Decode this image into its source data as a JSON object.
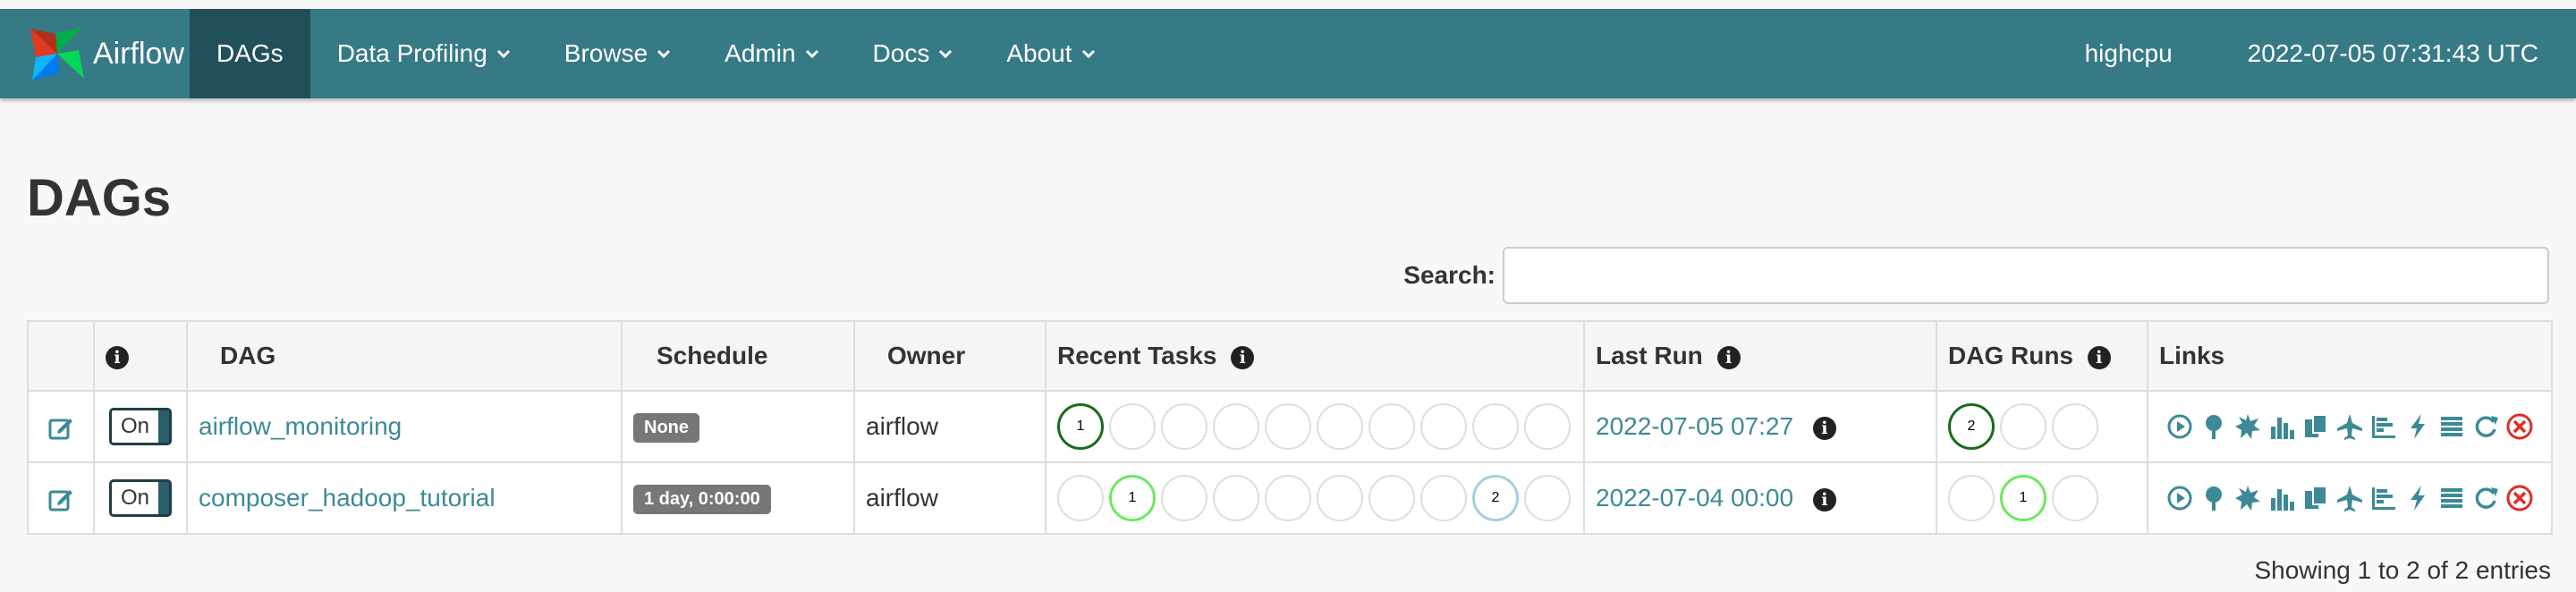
{
  "nav": {
    "brand": "Airflow",
    "items": [
      {
        "label": "DAGs",
        "active": true,
        "dropdown": false
      },
      {
        "label": "Data Profiling",
        "active": false,
        "dropdown": true
      },
      {
        "label": "Browse",
        "active": false,
        "dropdown": true
      },
      {
        "label": "Admin",
        "active": false,
        "dropdown": true
      },
      {
        "label": "Docs",
        "active": false,
        "dropdown": true
      },
      {
        "label": "About",
        "active": false,
        "dropdown": true
      }
    ],
    "hostname": "highcpu",
    "clock": "2022-07-05 07:31:43 UTC"
  },
  "page": {
    "title": "DAGs",
    "search_label": "Search:",
    "search_value": "",
    "footer": "Showing 1 to 2 of 2 entries"
  },
  "table": {
    "headers": {
      "info": "i",
      "dag": "DAG",
      "schedule": "Schedule",
      "owner": "Owner",
      "recent_tasks": "Recent Tasks",
      "last_run": "Last Run",
      "dag_runs": "DAG Runs",
      "links": "Links"
    },
    "rows": [
      {
        "toggle": "On",
        "dag": "airflow_monitoring",
        "schedule": "None",
        "owner": "airflow",
        "recent_tasks": [
          "1",
          "",
          "",
          "",
          "",
          "",
          "",
          "",
          "",
          ""
        ],
        "recent_task_states": [
          "success",
          "",
          "",
          "",
          "",
          "",
          "",
          "",
          "",
          ""
        ],
        "last_run": "2022-07-05 07:27",
        "dag_runs": [
          "2",
          "",
          ""
        ],
        "dag_run_states": [
          "success",
          "",
          ""
        ]
      },
      {
        "toggle": "On",
        "dag": "composer_hadoop_tutorial",
        "schedule": "1 day, 0:00:00",
        "owner": "airflow",
        "recent_tasks": [
          "",
          "1",
          "",
          "",
          "",
          "",
          "",
          "",
          "2",
          ""
        ],
        "recent_task_states": [
          "",
          "running",
          "",
          "",
          "",
          "",
          "",
          "",
          "retry",
          ""
        ],
        "last_run": "2022-07-04 00:00",
        "dag_runs": [
          "",
          "1",
          ""
        ],
        "dag_run_states": [
          "",
          "running",
          ""
        ]
      }
    ],
    "link_icons": [
      "trigger-dag-icon",
      "tree-view-icon",
      "graph-view-icon",
      "task-duration-icon",
      "task-tries-icon",
      "landing-times-icon",
      "gantt-icon",
      "code-icon",
      "logs-icon",
      "refresh-icon",
      "delete-icon"
    ]
  },
  "colors": {
    "navbar": "#367a85",
    "link": "#3c8a96",
    "success": "#1a6b1a",
    "running": "#6ee860",
    "delete": "#d9302c"
  }
}
